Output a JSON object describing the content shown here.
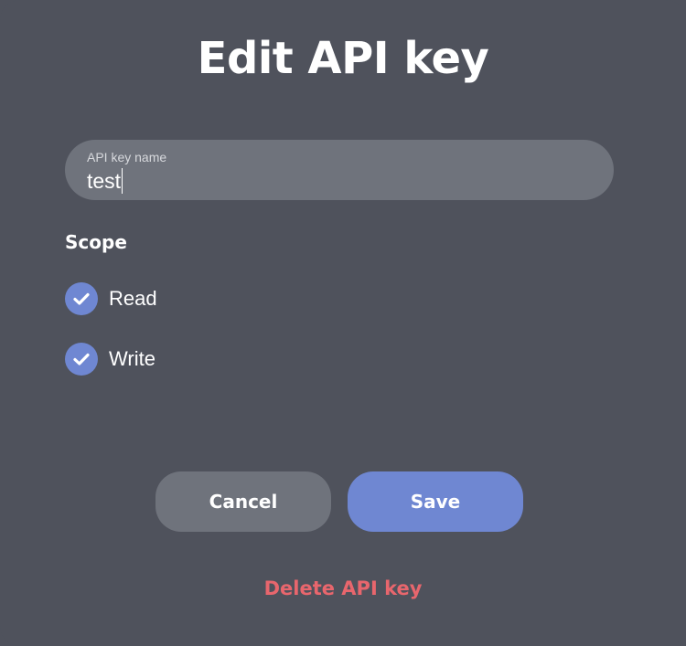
{
  "dialog": {
    "title": "Edit API key"
  },
  "name_field": {
    "label": "API key name",
    "value": "test"
  },
  "scope": {
    "heading": "Scope",
    "options": [
      {
        "label": "Read",
        "checked": true,
        "icon": "checkmark-icon"
      },
      {
        "label": "Write",
        "checked": true,
        "icon": "checkmark-icon"
      }
    ]
  },
  "actions": {
    "cancel_label": "Cancel",
    "save_label": "Save",
    "delete_label": "Delete API key"
  },
  "colors": {
    "background": "#4f525c",
    "field_bg": "#6f737c",
    "accent": "#6f87d2",
    "danger": "#e8666d"
  }
}
